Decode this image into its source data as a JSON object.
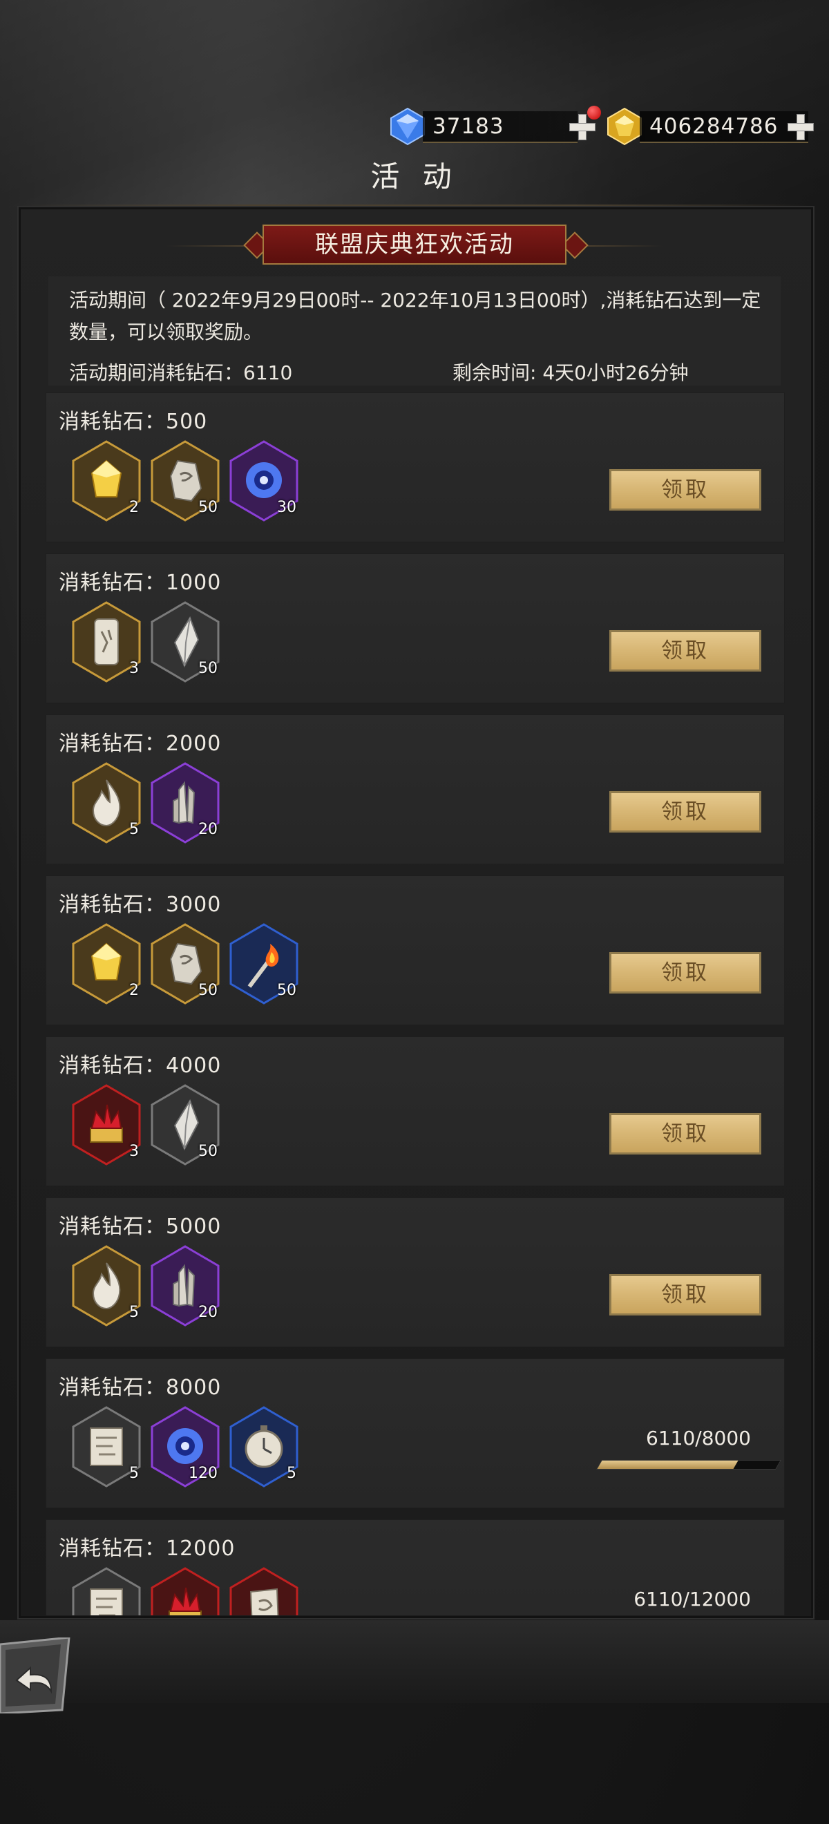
{
  "currency": {
    "diamonds": {
      "value": "37183",
      "icon": "blue-diamond-icon"
    },
    "gold": {
      "value": "406284786",
      "icon": "gold-crystal-icon"
    }
  },
  "title": "活 动",
  "event": {
    "banner": "联盟庆典狂欢活动",
    "description": "活动期间（ 2022年9月29日00时-- 2022年10月13日00时）,消耗钻石达到一定数量，可以领取奖励。",
    "spent_label": "活动期间消耗钻石：",
    "spent_value": "6110",
    "remaining_label": "剩余时间: ",
    "remaining_value": "4天0小时26分钟"
  },
  "tiers": [
    {
      "label": "消耗钻石：500",
      "action": "领取",
      "items": [
        {
          "icon": "gold-crystal-icon",
          "count": "2"
        },
        {
          "icon": "rune-stone-icon",
          "count": "50"
        },
        {
          "icon": "blue-orb-icon",
          "count": "30"
        }
      ]
    },
    {
      "label": "消耗钻石：1000",
      "action": "领取",
      "items": [
        {
          "icon": "scroll-tablet-icon",
          "count": "3"
        },
        {
          "icon": "white-crystal-icon",
          "count": "50"
        }
      ]
    },
    {
      "label": "消耗钻石：2000",
      "action": "领取",
      "items": [
        {
          "icon": "flame-icon",
          "count": "5"
        },
        {
          "icon": "crystal-cluster-icon",
          "count": "20"
        }
      ]
    },
    {
      "label": "消耗钻石：3000",
      "action": "领取",
      "items": [
        {
          "icon": "gold-crystal-icon",
          "count": "2"
        },
        {
          "icon": "rune-stone-icon",
          "count": "50"
        },
        {
          "icon": "torch-icon",
          "count": "50"
        }
      ]
    },
    {
      "label": "消耗钻石：4000",
      "action": "领取",
      "items": [
        {
          "icon": "red-crown-icon",
          "count": "3"
        },
        {
          "icon": "white-crystal-icon",
          "count": "50"
        }
      ]
    },
    {
      "label": "消耗钻石：5000",
      "action": "领取",
      "items": [
        {
          "icon": "flame-icon",
          "count": "5"
        },
        {
          "icon": "crystal-cluster-icon",
          "count": "20"
        }
      ]
    },
    {
      "label": "消耗钻石：8000",
      "progress": "6110/8000",
      "progress_fraction": 0.764,
      "items": [
        {
          "icon": "map-scroll-icon",
          "count": "5"
        },
        {
          "icon": "blue-orb-icon",
          "count": "120"
        },
        {
          "icon": "stopwatch-icon",
          "count": "5"
        }
      ]
    },
    {
      "label": "消耗钻石：12000",
      "progress": "6110/12000",
      "progress_fraction": 0.509,
      "items": [
        {
          "icon": "map-scroll-icon",
          "count": ""
        },
        {
          "icon": "red-crown-icon",
          "count": ""
        },
        {
          "icon": "rune-scroll-icon",
          "count": ""
        }
      ]
    }
  ],
  "colors": {
    "accent_gold": "#d7b674",
    "banner_red": "#7d1a17",
    "frame_gold": "#c79a3a",
    "frame_purple": "#8b3fd6",
    "frame_blue": "#2f5fd0",
    "frame_red": "#c02020",
    "frame_gray": "#7a7a7a"
  },
  "back_icon": "back-arrow-icon"
}
